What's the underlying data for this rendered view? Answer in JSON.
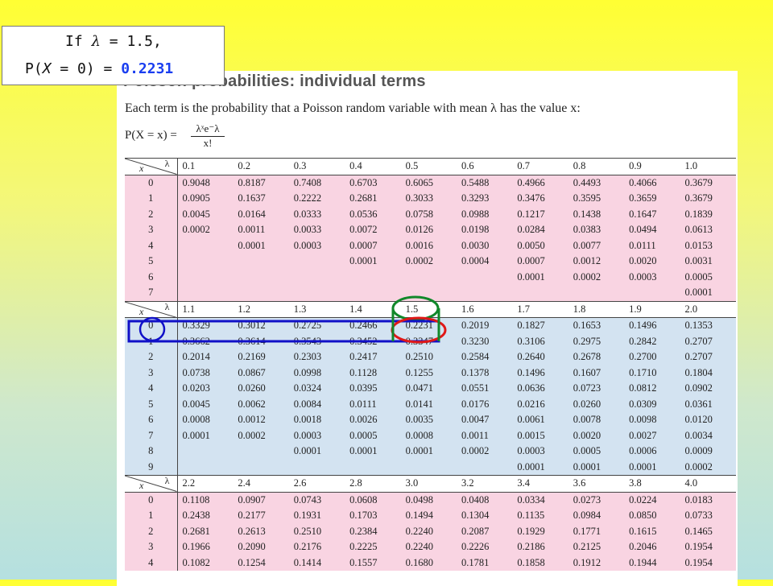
{
  "callout": {
    "line1_prefix": "If ",
    "lambda_symbol": "λ",
    "line1_suffix": " = 1.5,",
    "line2_prefix": "P(",
    "x_var": "X",
    "line2_mid": " = 0) = ",
    "highlight_value": "0.2231",
    "highlight_color": "#1a3ef0"
  },
  "page": {
    "title": "Poisson probabilities: individual terms",
    "intro": "Each term is the probability that a Poisson random variable with mean λ has the value x:",
    "formula_lhs": "P(X = x) =",
    "formula_num": "λˣe⁻λ",
    "formula_den": "x!"
  },
  "table": {
    "corner_x": "x",
    "corner_lambda": "λ",
    "blocks": [
      {
        "color": "pink",
        "lambdas": [
          "0.1",
          "0.2",
          "0.3",
          "0.4",
          "0.5",
          "0.6",
          "0.7",
          "0.8",
          "0.9",
          "1.0"
        ],
        "rows": [
          [
            "0",
            "0.9048",
            "0.8187",
            "0.7408",
            "0.6703",
            "0.6065",
            "0.5488",
            "0.4966",
            "0.4493",
            "0.4066",
            "0.3679"
          ],
          [
            "1",
            "0.0905",
            "0.1637",
            "0.2222",
            "0.2681",
            "0.3033",
            "0.3293",
            "0.3476",
            "0.3595",
            "0.3659",
            "0.3679"
          ],
          [
            "2",
            "0.0045",
            "0.0164",
            "0.0333",
            "0.0536",
            "0.0758",
            "0.0988",
            "0.1217",
            "0.1438",
            "0.1647",
            "0.1839"
          ],
          [
            "3",
            "0.0002",
            "0.0011",
            "0.0033",
            "0.0072",
            "0.0126",
            "0.0198",
            "0.0284",
            "0.0383",
            "0.0494",
            "0.0613"
          ],
          [
            "4",
            "",
            "0.0001",
            "0.0003",
            "0.0007",
            "0.0016",
            "0.0030",
            "0.0050",
            "0.0077",
            "0.0111",
            "0.0153"
          ],
          [
            "5",
            "",
            "",
            "",
            "0.0001",
            "0.0002",
            "0.0004",
            "0.0007",
            "0.0012",
            "0.0020",
            "0.0031"
          ],
          [
            "6",
            "",
            "",
            "",
            "",
            "",
            "",
            "0.0001",
            "0.0002",
            "0.0003",
            "0.0005"
          ],
          [
            "7",
            "",
            "",
            "",
            "",
            "",
            "",
            "",
            "",
            "",
            "0.0001"
          ]
        ]
      },
      {
        "color": "blue",
        "lambdas": [
          "1.1",
          "1.2",
          "1.3",
          "1.4",
          "1.5",
          "1.6",
          "1.7",
          "1.8",
          "1.9",
          "2.0"
        ],
        "rows": [
          [
            "0",
            "0.3329",
            "0.3012",
            "0.2725",
            "0.2466",
            "0.2231",
            "0.2019",
            "0.1827",
            "0.1653",
            "0.1496",
            "0.1353"
          ],
          [
            "1",
            "0.3662",
            "0.3614",
            "0.3543",
            "0.3452",
            "0.3347",
            "0.3230",
            "0.3106",
            "0.2975",
            "0.2842",
            "0.2707"
          ],
          [
            "2",
            "0.2014",
            "0.2169",
            "0.2303",
            "0.2417",
            "0.2510",
            "0.2584",
            "0.2640",
            "0.2678",
            "0.2700",
            "0.2707"
          ],
          [
            "3",
            "0.0738",
            "0.0867",
            "0.0998",
            "0.1128",
            "0.1255",
            "0.1378",
            "0.1496",
            "0.1607",
            "0.1710",
            "0.1804"
          ],
          [
            "4",
            "0.0203",
            "0.0260",
            "0.0324",
            "0.0395",
            "0.0471",
            "0.0551",
            "0.0636",
            "0.0723",
            "0.0812",
            "0.0902"
          ],
          [
            "5",
            "0.0045",
            "0.0062",
            "0.0084",
            "0.0111",
            "0.0141",
            "0.0176",
            "0.0216",
            "0.0260",
            "0.0309",
            "0.0361"
          ],
          [
            "6",
            "0.0008",
            "0.0012",
            "0.0018",
            "0.0026",
            "0.0035",
            "0.0047",
            "0.0061",
            "0.0078",
            "0.0098",
            "0.0120"
          ],
          [
            "7",
            "0.0001",
            "0.0002",
            "0.0003",
            "0.0005",
            "0.0008",
            "0.0011",
            "0.0015",
            "0.0020",
            "0.0027",
            "0.0034"
          ],
          [
            "8",
            "",
            "",
            "0.0001",
            "0.0001",
            "0.0001",
            "0.0002",
            "0.0003",
            "0.0005",
            "0.0006",
            "0.0009"
          ],
          [
            "9",
            "",
            "",
            "",
            "",
            "",
            "",
            "0.0001",
            "0.0001",
            "0.0001",
            "0.0002"
          ]
        ]
      },
      {
        "color": "pink",
        "lambdas": [
          "2.2",
          "2.4",
          "2.6",
          "2.8",
          "3.0",
          "3.2",
          "3.4",
          "3.6",
          "3.8",
          "4.0"
        ],
        "rows": [
          [
            "0",
            "0.1108",
            "0.0907",
            "0.0743",
            "0.0608",
            "0.0498",
            "0.0408",
            "0.0334",
            "0.0273",
            "0.0224",
            "0.0183"
          ],
          [
            "1",
            "0.2438",
            "0.2177",
            "0.1931",
            "0.1703",
            "0.1494",
            "0.1304",
            "0.1135",
            "0.0984",
            "0.0850",
            "0.0733"
          ],
          [
            "2",
            "0.2681",
            "0.2613",
            "0.2510",
            "0.2384",
            "0.2240",
            "0.2087",
            "0.1929",
            "0.1771",
            "0.1615",
            "0.1465"
          ],
          [
            "3",
            "0.1966",
            "0.2090",
            "0.2176",
            "0.2225",
            "0.2240",
            "0.2226",
            "0.2186",
            "0.2125",
            "0.2046",
            "0.1954"
          ],
          [
            "4",
            "0.1082",
            "0.1254",
            "0.1414",
            "0.1557",
            "0.1680",
            "0.1781",
            "0.1858",
            "0.1912",
            "0.1944",
            "0.1954"
          ]
        ]
      }
    ]
  },
  "annotations": {
    "lambda_header_circle_color": "#11882a",
    "value_circle_color": "#e01818",
    "row_box_color": "#1010c8",
    "x_circle_color": "#1010c8"
  }
}
